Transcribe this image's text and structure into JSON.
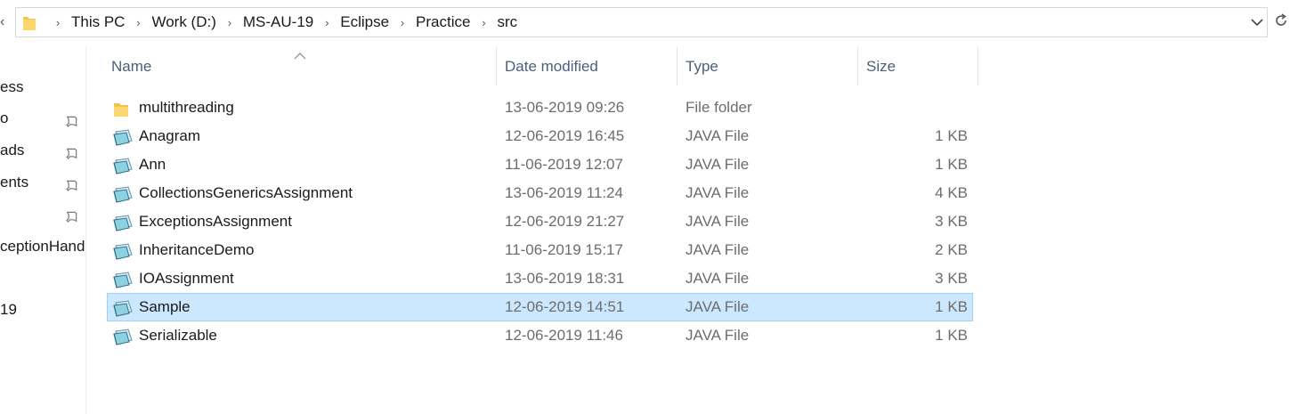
{
  "address_bar": {
    "crumbs": [
      "This PC",
      "Work (D:)",
      "MS-AU-19",
      "Eclipse",
      "Practice",
      "src"
    ]
  },
  "nav_pane": {
    "items": [
      {
        "label": "ess",
        "pinned": false
      },
      {
        "label": "o",
        "pinned": true
      },
      {
        "label": "ads",
        "pinned": true
      },
      {
        "label": "ents",
        "pinned": true
      },
      {
        "label": "",
        "pinned": true
      },
      {
        "label": "ceptionHand",
        "pinned": false
      },
      {
        "label": "19",
        "pinned": false
      }
    ]
  },
  "columns": {
    "name": "Name",
    "date_modified": "Date modified",
    "type": "Type",
    "size": "Size"
  },
  "files": [
    {
      "name": "multithreading",
      "date": "13-06-2019 09:26",
      "type": "File folder",
      "size": "",
      "icon": "folder-icon",
      "selected": false
    },
    {
      "name": "Anagram",
      "date": "12-06-2019 16:45",
      "type": "JAVA File",
      "size": "1 KB",
      "icon": "java-file-icon",
      "selected": false
    },
    {
      "name": "Ann",
      "date": "11-06-2019 12:07",
      "type": "JAVA File",
      "size": "1 KB",
      "icon": "java-file-icon",
      "selected": false
    },
    {
      "name": "CollectionsGenericsAssignment",
      "date": "13-06-2019 11:24",
      "type": "JAVA File",
      "size": "4 KB",
      "icon": "java-file-icon",
      "selected": false
    },
    {
      "name": "ExceptionsAssignment",
      "date": "12-06-2019 21:27",
      "type": "JAVA File",
      "size": "3 KB",
      "icon": "java-file-icon",
      "selected": false
    },
    {
      "name": "InheritanceDemo",
      "date": "11-06-2019 15:17",
      "type": "JAVA File",
      "size": "2 KB",
      "icon": "java-file-icon",
      "selected": false
    },
    {
      "name": "IOAssignment",
      "date": "13-06-2019 18:31",
      "type": "JAVA File",
      "size": "3 KB",
      "icon": "java-file-icon",
      "selected": false
    },
    {
      "name": "Sample",
      "date": "12-06-2019 14:51",
      "type": "JAVA File",
      "size": "1 KB",
      "icon": "java-file-icon",
      "selected": true
    },
    {
      "name": "Serializable",
      "date": "12-06-2019 11:46",
      "type": "JAVA File",
      "size": "1 KB",
      "icon": "java-file-icon",
      "selected": false
    }
  ],
  "colors": {
    "selection_bg": "#cce8ff",
    "selection_border": "#99d1ff",
    "header_text": "#4c607a",
    "folder": "#f4c24f"
  }
}
